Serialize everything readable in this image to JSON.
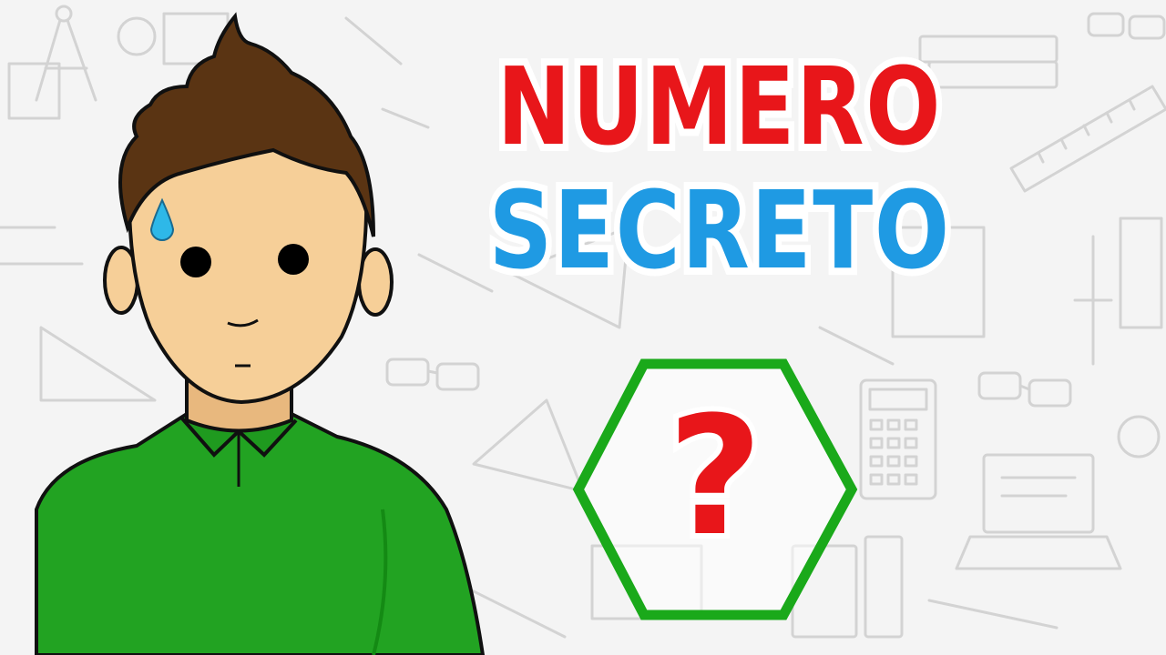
{
  "title": {
    "line1": "NUMERO",
    "line2": "SECRETO"
  },
  "puzzle": {
    "symbol": "?"
  },
  "colors": {
    "line1": "#e8161a",
    "line2": "#1f9ae3",
    "hexagon": "#1aa91a",
    "symbol": "#e8161a",
    "shirt": "#22a322",
    "skin": "#f6cf98",
    "hair": "#5a3413",
    "drop": "#2eb8e8",
    "background": "#f4f4f4",
    "doodle": "#cfcfcf"
  },
  "icons": [
    "sweat-drop-icon",
    "compass-icon",
    "calculator-icon",
    "glasses-icon",
    "ruler-icon",
    "laptop-icon",
    "book-icon",
    "triangle-icon"
  ]
}
